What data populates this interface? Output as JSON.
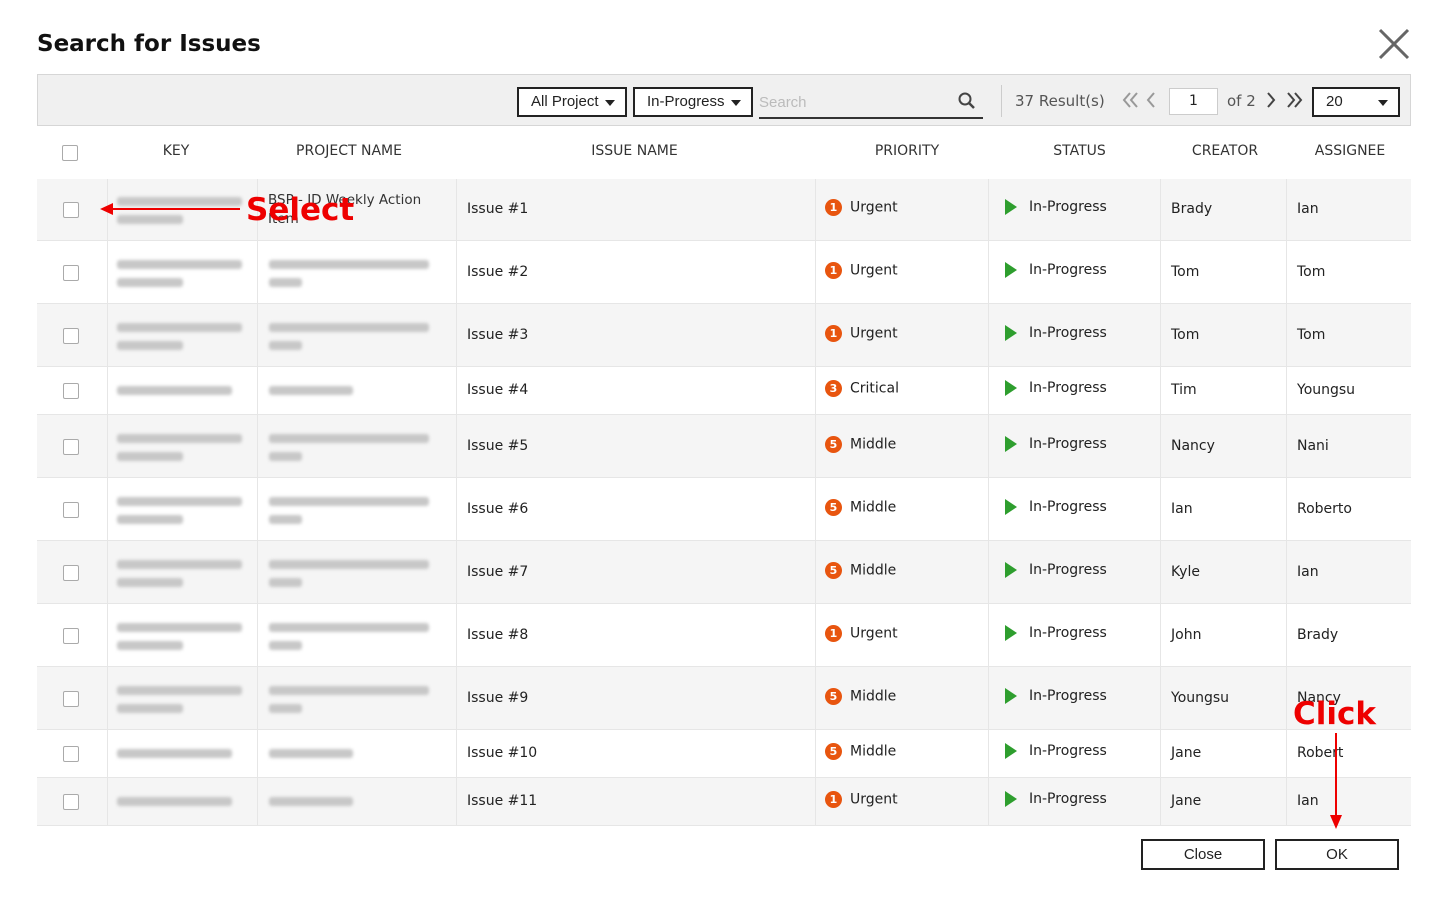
{
  "dialog": {
    "title": "Search for Issues"
  },
  "toolbar": {
    "project_filter": "All Project",
    "status_filter": "In-Progress",
    "search_placeholder": "Search",
    "results": "37 Result(s)",
    "page": "1",
    "of_pages": "of 2",
    "page_size": "20"
  },
  "table": {
    "headers": {
      "key": "KEY",
      "project": "PROJECT NAME",
      "issue": "ISSUE NAME",
      "priority": "PRIORITY",
      "status": "STATUS",
      "creator": "CREATOR",
      "assignee": "ASSIGNEE"
    },
    "rows": [
      {
        "project_partial": "BSP - JD Weekly Action Item",
        "issue": "Issue #1",
        "priority_num": "1",
        "priority": "Urgent",
        "status": "In-Progress",
        "creator": "Brady",
        "assignee": "Ian"
      },
      {
        "issue": "Issue #2",
        "priority_num": "1",
        "priority": "Urgent",
        "status": "In-Progress",
        "creator": "Tom",
        "assignee": "Tom"
      },
      {
        "issue": "Issue #3",
        "priority_num": "1",
        "priority": "Urgent",
        "status": "In-Progress",
        "creator": "Tom",
        "assignee": "Tom"
      },
      {
        "issue": "Issue #4",
        "priority_num": "3",
        "priority": "Critical",
        "status": "In-Progress",
        "creator": "Tim",
        "assignee": "Youngsu"
      },
      {
        "issue": "Issue #5",
        "priority_num": "5",
        "priority": "Middle",
        "status": "In-Progress",
        "creator": "Nancy",
        "assignee": "Nani"
      },
      {
        "issue": "Issue #6",
        "priority_num": "5",
        "priority": "Middle",
        "status": "In-Progress",
        "creator": "Ian",
        "assignee": "Roberto"
      },
      {
        "issue": "Issue #7",
        "priority_num": "5",
        "priority": "Middle",
        "status": "In-Progress",
        "creator": "Kyle",
        "assignee": "Ian"
      },
      {
        "issue": "Issue #8",
        "priority_num": "1",
        "priority": "Urgent",
        "status": "In-Progress",
        "creator": "John",
        "assignee": "Brady"
      },
      {
        "issue": "Issue #9",
        "priority_num": "5",
        "priority": "Middle",
        "status": "In-Progress",
        "creator": "Youngsu",
        "assignee": "Nancy"
      },
      {
        "issue": "Issue #10",
        "priority_num": "5",
        "priority": "Middle",
        "status": "In-Progress",
        "creator": "Jane",
        "assignee": "Robert"
      },
      {
        "issue": "Issue #11",
        "priority_num": "1",
        "priority": "Urgent",
        "status": "In-Progress",
        "creator": "Jane",
        "assignee": "Ian"
      }
    ]
  },
  "footer": {
    "close_label": "Close",
    "ok_label": "OK"
  },
  "annotations": {
    "select": "Select",
    "click": "Click"
  },
  "colors": {
    "priority_badge": "#e8550f",
    "status_play": "#2e9e2e",
    "annotation": "#ee0000"
  }
}
